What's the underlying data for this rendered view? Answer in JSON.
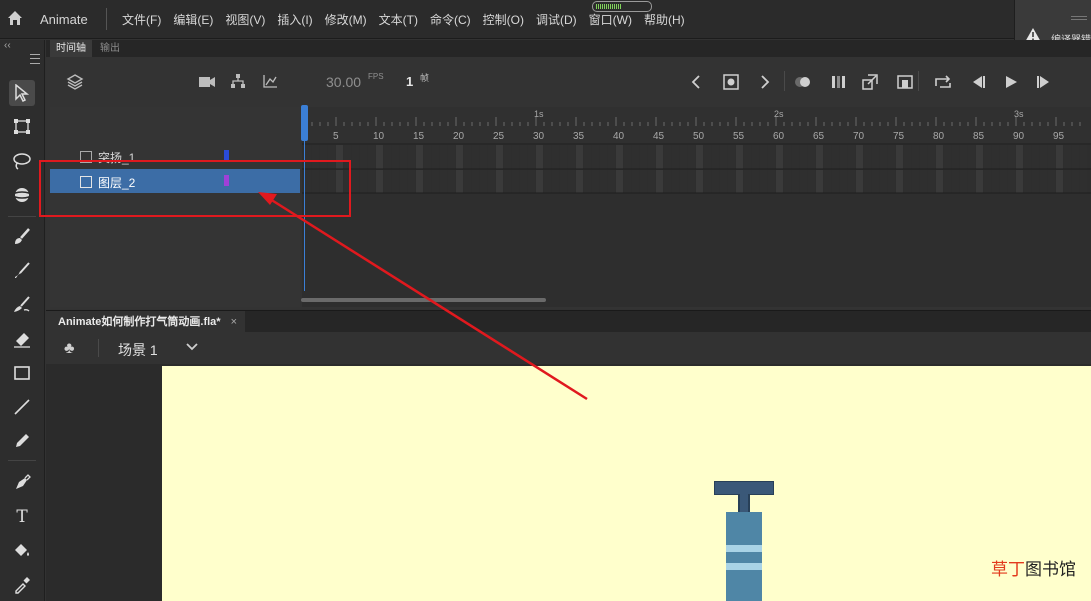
{
  "app": {
    "name": "Animate"
  },
  "menu": [
    "文件(F)",
    "编辑(E)",
    "视图(V)",
    "插入(I)",
    "修改(M)",
    "文本(T)",
    "命令(C)",
    "控制(O)",
    "调试(D)",
    "窗口(W)",
    "帮助(H)"
  ],
  "compile_panel": {
    "label": "编译器错"
  },
  "panel_tabs": {
    "timeline": "时间轴",
    "output": "输出"
  },
  "timeline": {
    "fps_value": "30.00",
    "fps_unit": "FPS",
    "frame_number": "1",
    "frame_unit": "帧",
    "ruler_numbers": [
      "5",
      "10",
      "15",
      "20",
      "25",
      "30",
      "35",
      "40",
      "45",
      "50",
      "55",
      "60",
      "65",
      "70",
      "75",
      "80",
      "85",
      "90",
      "95"
    ],
    "seconds": [
      "1s",
      "2s",
      "3s"
    ],
    "layers": [
      {
        "name": "突扬_1",
        "color": "#2a4bd8",
        "selected": false
      },
      {
        "name": "图层_2",
        "color": "#a040d8",
        "selected": true
      }
    ]
  },
  "document": {
    "tab_title": "Animate如何制作打气筒动画.fla*",
    "close_symbol": "×",
    "scene_label": "场景 1"
  },
  "stage": {
    "background": "#ffffcc"
  },
  "watermark": {
    "part1": "草丁",
    "part2": "图书馆"
  },
  "colors": {
    "accent": "#3b7fd6",
    "selected_layer": "#3c6da6",
    "annotation": "#e0191e"
  }
}
